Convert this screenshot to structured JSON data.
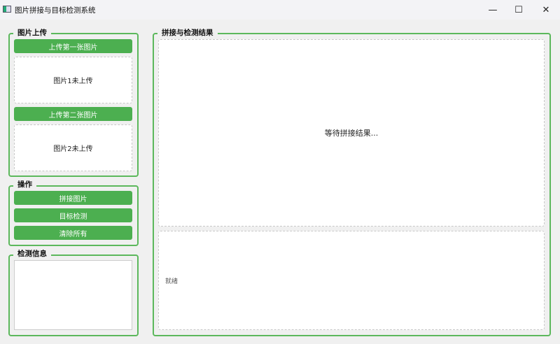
{
  "window": {
    "title": "图片拼接与目标检测系统",
    "minimize": "—",
    "maximize": "☐",
    "close": "✕"
  },
  "upload": {
    "title": "图片上传",
    "btn1": "上传第一张图片",
    "placeholder1": "图片1未上传",
    "btn2": "上传第二张图片",
    "placeholder2": "图片2未上传"
  },
  "ops": {
    "title": "操作",
    "stitch": "拼接图片",
    "detect": "目标检测",
    "clear": "清除所有"
  },
  "info": {
    "title": "检测信息",
    "content": ""
  },
  "result": {
    "title": "拼接与检测结果",
    "waiting": "等待拼接结果...",
    "status": "就绪"
  },
  "colors": {
    "accent": "#4caf50",
    "border": "#5cb85c"
  }
}
